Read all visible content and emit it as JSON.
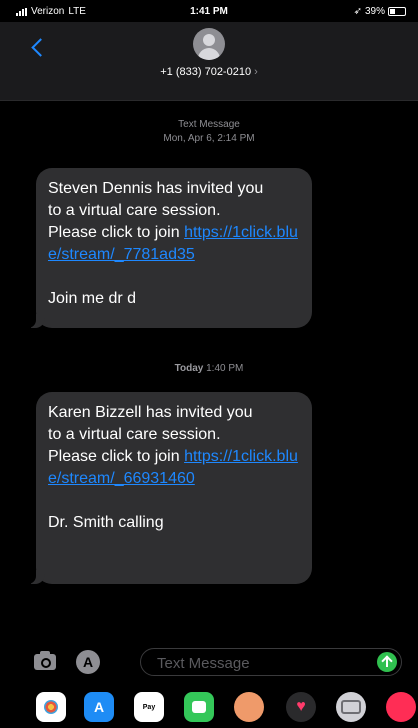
{
  "status_bar": {
    "carrier": "Verizon",
    "network": "LTE",
    "time": "1:41 PM",
    "battery": "39%"
  },
  "header": {
    "contact": "+1 (833) 702-0210",
    "chevron": "›"
  },
  "thread": {
    "first_stamp_title": "Text Message",
    "first_stamp_date": "Mon, Apr 6, 2:14 PM",
    "messages": [
      {
        "line1": "Steven Dennis has invited you",
        "line2": "to a virtual care session.",
        "line3": "Please click to join ",
        "link": "https://1click.blue/stream/_7781ad35",
        "footer": "Join me dr d"
      },
      {
        "line1": "Karen Bizzell has invited you",
        "line2": "to a virtual care session.",
        "line3": "Please click to join ",
        "link": "https://1click.blue/stream/_66931460",
        "footer": "Dr. Smith calling"
      }
    ],
    "second_stamp_day": "Today",
    "second_stamp_time": "1:40 PM"
  },
  "composer": {
    "placeholder": "Text Message",
    "value": ""
  },
  "app_drawer": {
    "apps": [
      "photos-icon",
      "app-store-icon",
      "apple-pay-icon",
      "memoji-icon",
      "animoji-icon",
      "digital-touch-icon",
      "more-apps-icon",
      "music-icon"
    ],
    "pay_label": "Pay"
  },
  "colors": {
    "accent": "#1e88ff",
    "send": "#30c04f",
    "bubble": "#2f2f31"
  }
}
